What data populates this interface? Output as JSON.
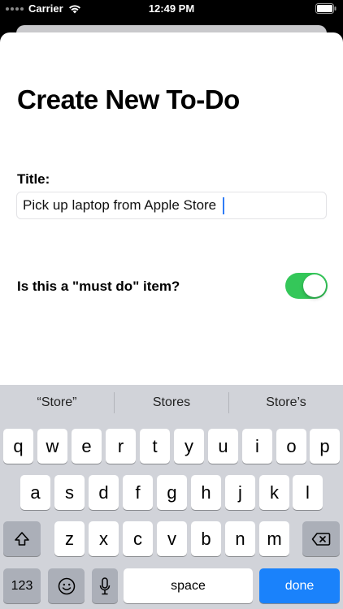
{
  "status_bar": {
    "carrier": "Carrier",
    "time": "12:49 PM"
  },
  "page": {
    "title": "Create New To-Do"
  },
  "form": {
    "title_label": "Title:",
    "title_value": "Pick up laptop from Apple Store",
    "must_do_label": "Is this a \"must do\" item?",
    "must_do_on": true
  },
  "keyboard": {
    "predictions": [
      "“Store”",
      "Stores",
      "Store’s"
    ],
    "row1": [
      "q",
      "w",
      "e",
      "r",
      "t",
      "y",
      "u",
      "i",
      "o",
      "p"
    ],
    "row2": [
      "a",
      "s",
      "d",
      "f",
      "g",
      "h",
      "j",
      "k",
      "l"
    ],
    "row3": [
      "z",
      "x",
      "c",
      "v",
      "b",
      "n",
      "m"
    ],
    "numbers_label": "123",
    "space_label": "space",
    "done_label": "done"
  },
  "colors": {
    "toggle_on": "#34c759",
    "done_key": "#1a82fb",
    "keyboard_bg": "#d1d3d9"
  },
  "icons": {
    "status": [
      "wifi-icon",
      "battery-icon"
    ],
    "keyboard": [
      "shift-icon",
      "delete-icon",
      "emoji-icon",
      "microphone-icon"
    ]
  }
}
